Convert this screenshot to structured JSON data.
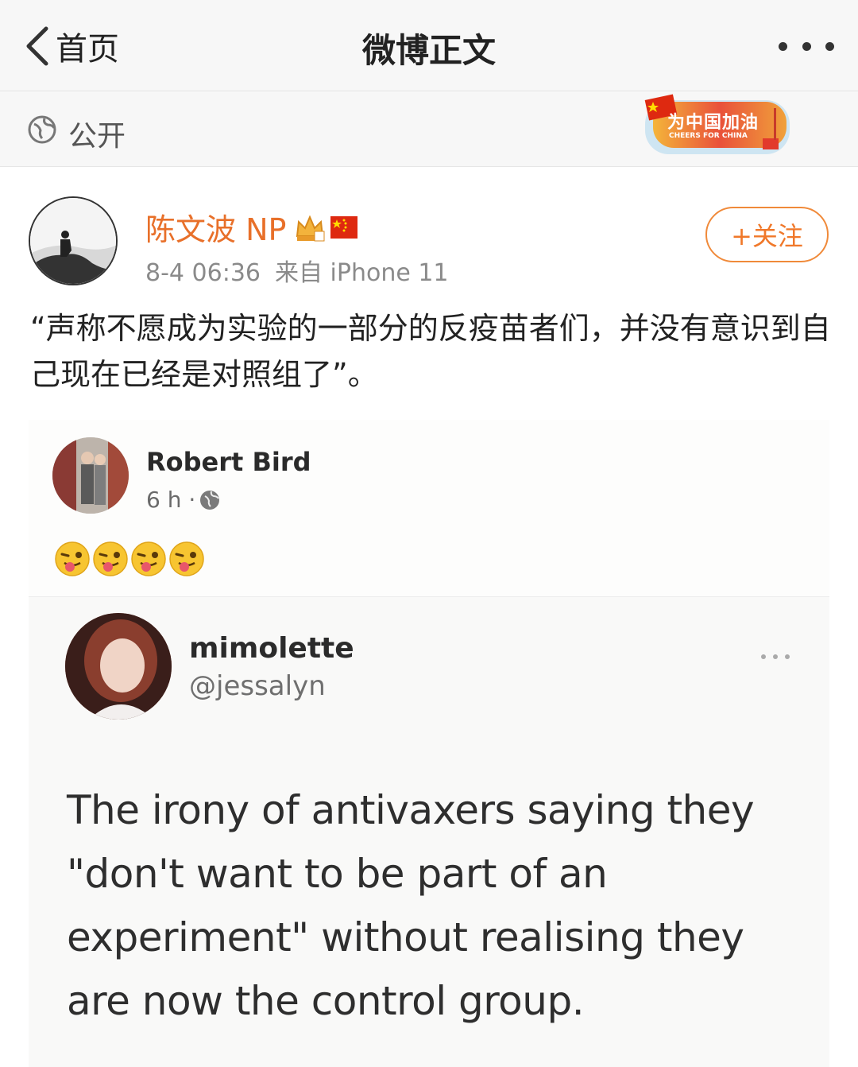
{
  "navbar": {
    "back_label": "首页",
    "title": "微博正文"
  },
  "visibility": {
    "label": "公开"
  },
  "badge": {
    "title": "为中国加油",
    "subtitle": "CHEERS FOR CHINA"
  },
  "post": {
    "author": "陈文波 NP",
    "time": "8-4 06:36",
    "source": "来自 iPhone 11",
    "follow_label": "+关注",
    "text": "“声称不愿成为实验的一部分的反疫苗者们，并没有意识到自己现在已经是对照组了”。"
  },
  "embed": {
    "fb": {
      "name": "Robert Bird",
      "time": "6 h ·"
    },
    "tweet": {
      "name": "mimolette",
      "handle": "@jessalyn",
      "text": "The irony of antivaxers saying they \"don't want to be part of an experiment\" without realising they are now the control group."
    }
  },
  "colors": {
    "accent": "#f0782a",
    "author": "#e8702a",
    "navbar_bg": "#f7f7f7"
  }
}
